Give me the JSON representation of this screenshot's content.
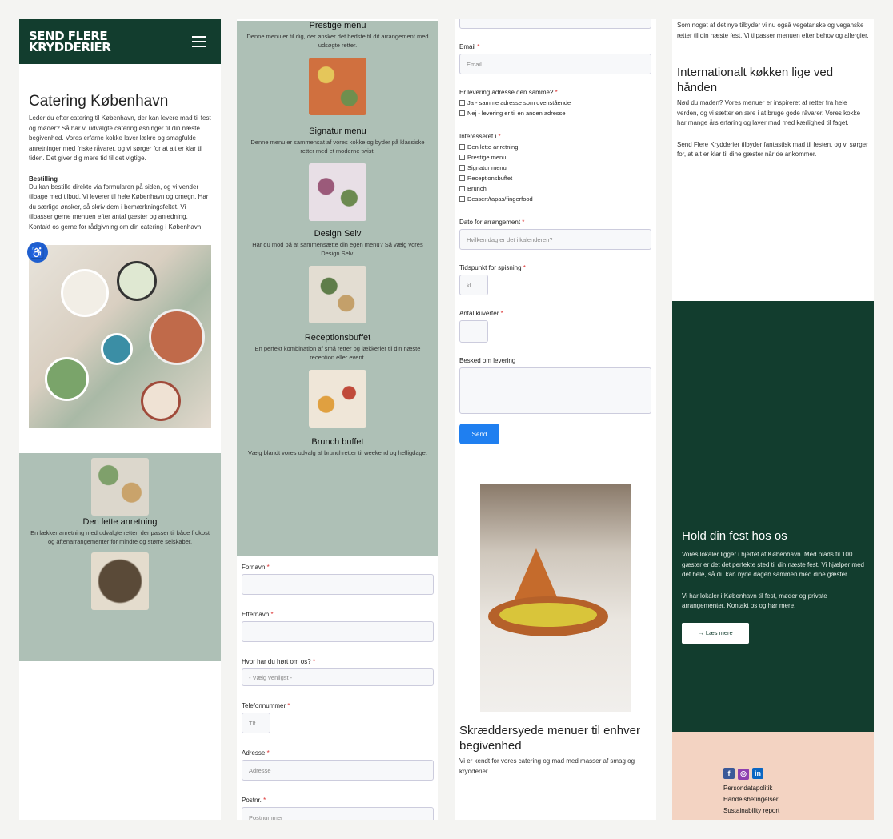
{
  "header": {
    "logo_line1": "SEND FLERE",
    "logo_line2": "KRYDDERIER"
  },
  "col1": {
    "title": "Catering København",
    "intro": "Leder du efter catering til København, der kan levere mad til fest og møder? Så har vi udvalgte cateringløsninger til din næste begivenhed. Vores erfarne kokke laver lækre og smagfulde anretninger med friske råvarer, og vi sørger for at alt er klar til tiden. Det giver dig mere tid til det vigtige.",
    "order_heading": "Bestilling",
    "order_text": "Du kan bestille direkte via formularen på siden, og vi vender tilbage med tilbud. Vi leverer til hele København og omegn. Har du særlige ønsker, så skriv dem i bemærkningsfeltet. Vi tilpasser gerne menuen efter antal gæster og anledning. Kontakt os gerne for rådgivning om din catering i København.",
    "featured_title": "Den lette anretning",
    "featured_desc": "En lækker anretning med udvalgte retter, der passer til både frokost og aftenarrangementer for mindre og større selskaber."
  },
  "col2": {
    "menus": [
      {
        "title": "Prestige menu",
        "desc": "Denne menu er til dig, der ønsker det bedste til dit arrangement med udsøgte retter."
      },
      {
        "title": "Signatur menu",
        "desc": "Denne menu er sammensat af vores kokke og byder på klassiske retter med et moderne twist."
      },
      {
        "title": "Design Selv",
        "desc": "Har du mod på at sammensætte din egen menu? Så vælg vores Design Selv."
      },
      {
        "title": "Receptionsbuffet",
        "desc": "En perfekt kombination af små retter og lækkerier til din næste reception eller event."
      },
      {
        "title": "Brunch buffet",
        "desc": "Vælg blandt vores udvalg af brunchretter til weekend og helligdage."
      }
    ],
    "form": {
      "firstname_label": "Fornavn",
      "lastname_label": "Efternavn",
      "hear_label": "Hvor har du hørt om os?",
      "hear_placeholder": "- Vælg venligst -",
      "phone_label": "Telefonnummer",
      "phone_placeholder": "Tlf.",
      "address_label": "Adresse",
      "address_placeholder": "Adresse",
      "zip_label": "Postnr.",
      "zip_placeholder": "Postnummer"
    }
  },
  "col3": {
    "email_label": "Email",
    "email_placeholder": "Email",
    "delivery_label": "Er levering adresse den samme?",
    "delivery_opts": [
      "Ja - samme adresse som ovenstående",
      "Nej - levering er til en anden adresse"
    ],
    "interest_label": "Interesseret i",
    "interest_opts": [
      "Den lette anretning",
      "Prestige menu",
      "Signatur menu",
      "Receptionsbuffet",
      "Brunch",
      "Dessert/tapas/fingerfood"
    ],
    "date_label": "Dato for arrangement",
    "date_placeholder": "Hvilken dag er det i kalenderen?",
    "time_label": "Tidspunkt for spisning",
    "time_placeholder": "kl.",
    "guests_label": "Antal kuverter",
    "comment_label": "Besked om levering",
    "send_label": "Send",
    "headline": "Skræddersyede menuer til enhver begivenhed",
    "headline_text": "Vi er kendt for vores catering og mad med masser af smag og krydderier."
  },
  "col4": {
    "top_text": "Som noget af det nye tilbyder vi nu også vegetariske og veganske retter til din næste fest. Vi tilpasser menuen efter behov og allergier.",
    "intl_title": "Internationalt køkken lige ved hånden",
    "intl_text": "Nød du maden? Vores menuer er inspireret af retter fra hele verden, og vi sætter en ære i at bruge gode råvarer. Vores kokke har mange års erfaring og laver mad med kærlighed til faget.",
    "intl_text2": "Send Flere Krydderier tilbyder fantastisk mad til festen, og vi sørger for, at alt er klar til dine gæster når de ankommer.",
    "party_title": "Hold din fest hos os",
    "party_text": "Vores lokaler ligger i hjertet af København. Med plads til 100 gæster er det det perfekte sted til din næste fest. Vi hjælper med det hele, så du kan nyde dagen sammen med dine gæster.",
    "party_text2": "Vi har lokaler i København til fest, møder og private arrangementer. Kontakt os og hør mere.",
    "party_btn": "→ Læs mere",
    "footer_links": [
      "Persondatapolitik",
      "Handelsbetingelser",
      "Sustainability report"
    ]
  }
}
